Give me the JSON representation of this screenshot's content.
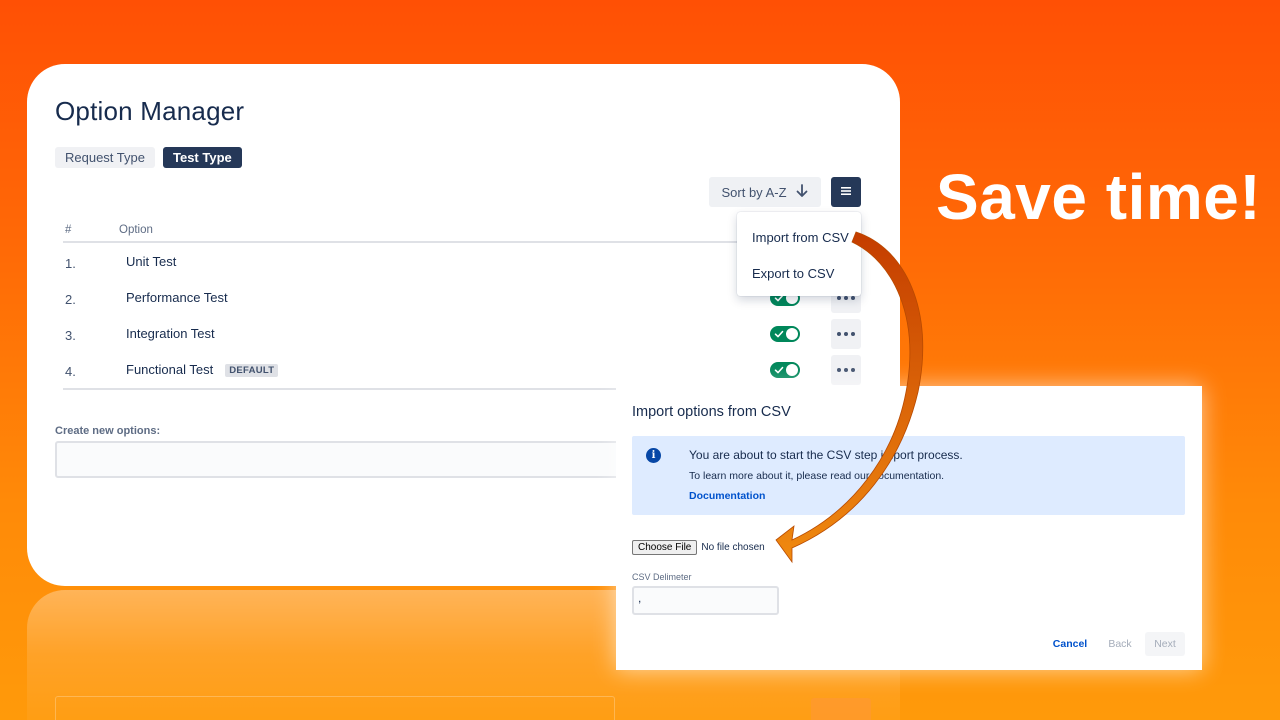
{
  "headline": "Save time!",
  "option_manager": {
    "title": "Option Manager",
    "tabs": [
      {
        "label": "Request Type",
        "active": false
      },
      {
        "label": "Test Type",
        "active": true
      }
    ],
    "sort_label": "Sort by A-Z",
    "table": {
      "headers": {
        "number": "#",
        "option": "Option"
      },
      "rows": [
        {
          "number": "1.",
          "name": "Unit Test",
          "badge": ""
        },
        {
          "number": "2.",
          "name": "Performance Test",
          "badge": ""
        },
        {
          "number": "3.",
          "name": "Integration Test",
          "badge": ""
        },
        {
          "number": "4.",
          "name": "Functional Test",
          "badge": "DEFAULT"
        }
      ]
    },
    "menu": {
      "items": [
        {
          "label": "Import from CSV"
        },
        {
          "label": "Export to CSV"
        }
      ]
    },
    "create_label": "Create new options:"
  },
  "import_modal": {
    "title": "Import options from CSV",
    "info": {
      "heading": "You are about to start the CSV step import process.",
      "text": "To learn more about it, please read our documentation.",
      "link": "Documentation"
    },
    "file": {
      "button": "Choose File",
      "status": "No file chosen"
    },
    "delimiter": {
      "label": "CSV Delimeter",
      "value": ","
    },
    "buttons": {
      "cancel": "Cancel",
      "back": "Back",
      "next": "Next"
    }
  },
  "colors": {
    "background_top": "#ff5005",
    "background_bottom": "#ff9a0a",
    "primary_dark": "#253858",
    "toggle_on": "#00875a",
    "link": "#0052cc",
    "info_bg": "#deebff",
    "arrow": "#f07a10"
  }
}
